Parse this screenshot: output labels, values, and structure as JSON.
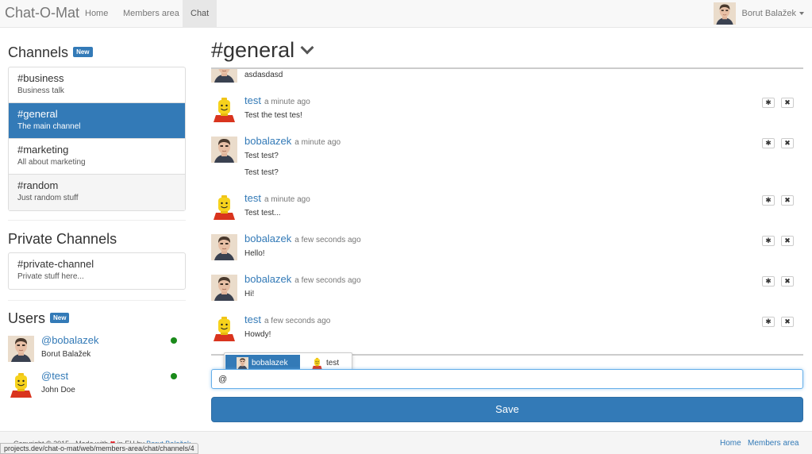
{
  "navbar": {
    "brand": "Chat-O-Mat",
    "links": [
      "Home",
      "Members area",
      "Chat"
    ],
    "user_name": "Borut Balažek"
  },
  "sidebar": {
    "channels_heading": "Channels",
    "new_badge": "New",
    "channels": [
      {
        "name": "#business",
        "desc": "Business talk"
      },
      {
        "name": "#general",
        "desc": "The main channel"
      },
      {
        "name": "#marketing",
        "desc": "All about marketing"
      },
      {
        "name": "#random",
        "desc": "Just random stuff"
      }
    ],
    "private_heading": "Private Channels",
    "private_channels": [
      {
        "name": "#private-channel",
        "desc": "Private stuff here..."
      }
    ],
    "users_heading": "Users",
    "users": [
      {
        "handle": "@bobalazek",
        "name": "Borut Balažek",
        "status": "online"
      },
      {
        "handle": "@test",
        "name": "John Doe",
        "status": "online"
      }
    ]
  },
  "channel": {
    "title": "#general"
  },
  "messages": [
    {
      "user": "",
      "time": "",
      "lines": [
        "asdasdasd"
      ],
      "avatar": "man"
    },
    {
      "user": "test",
      "time": "a minute ago",
      "lines": [
        "Test the test tes!"
      ],
      "avatar": "lego"
    },
    {
      "user": "bobalazek",
      "time": "a minute ago",
      "lines": [
        "Test test?",
        "Test test?"
      ],
      "avatar": "man"
    },
    {
      "user": "test",
      "time": "a minute ago",
      "lines": [
        "Test test..."
      ],
      "avatar": "lego"
    },
    {
      "user": "bobalazek",
      "time": "a few seconds ago",
      "lines": [
        "Hello!"
      ],
      "avatar": "man"
    },
    {
      "user": "bobalazek",
      "time": "a few seconds ago",
      "lines": [
        "Hi!"
      ],
      "avatar": "man"
    },
    {
      "user": "test",
      "time": "a few seconds ago",
      "lines": [
        "Howdy!"
      ],
      "avatar": "lego"
    }
  ],
  "message_actions": {
    "edit_icon": "gear-icon",
    "delete_icon": "close-icon",
    "edit_glyph": "✱",
    "delete_glyph": "✖"
  },
  "mention_popup": {
    "items": [
      {
        "label": "bobalazek",
        "active": true
      },
      {
        "label": "test",
        "active": false
      }
    ]
  },
  "composer": {
    "value": "@"
  },
  "save_label": "Save",
  "footer": {
    "copyright": "Copyright © 2015 - Made with",
    "in_eu": "in EU by",
    "author": "Borut Balažek",
    "links": [
      "Home",
      "Members area"
    ]
  },
  "status_url": "projects.dev/chat-o-mat/web/members-area/chat/channels/4",
  "colors": {
    "primary": "#337ab7",
    "online": "#1a8a1a",
    "heart": "#e31b23"
  }
}
